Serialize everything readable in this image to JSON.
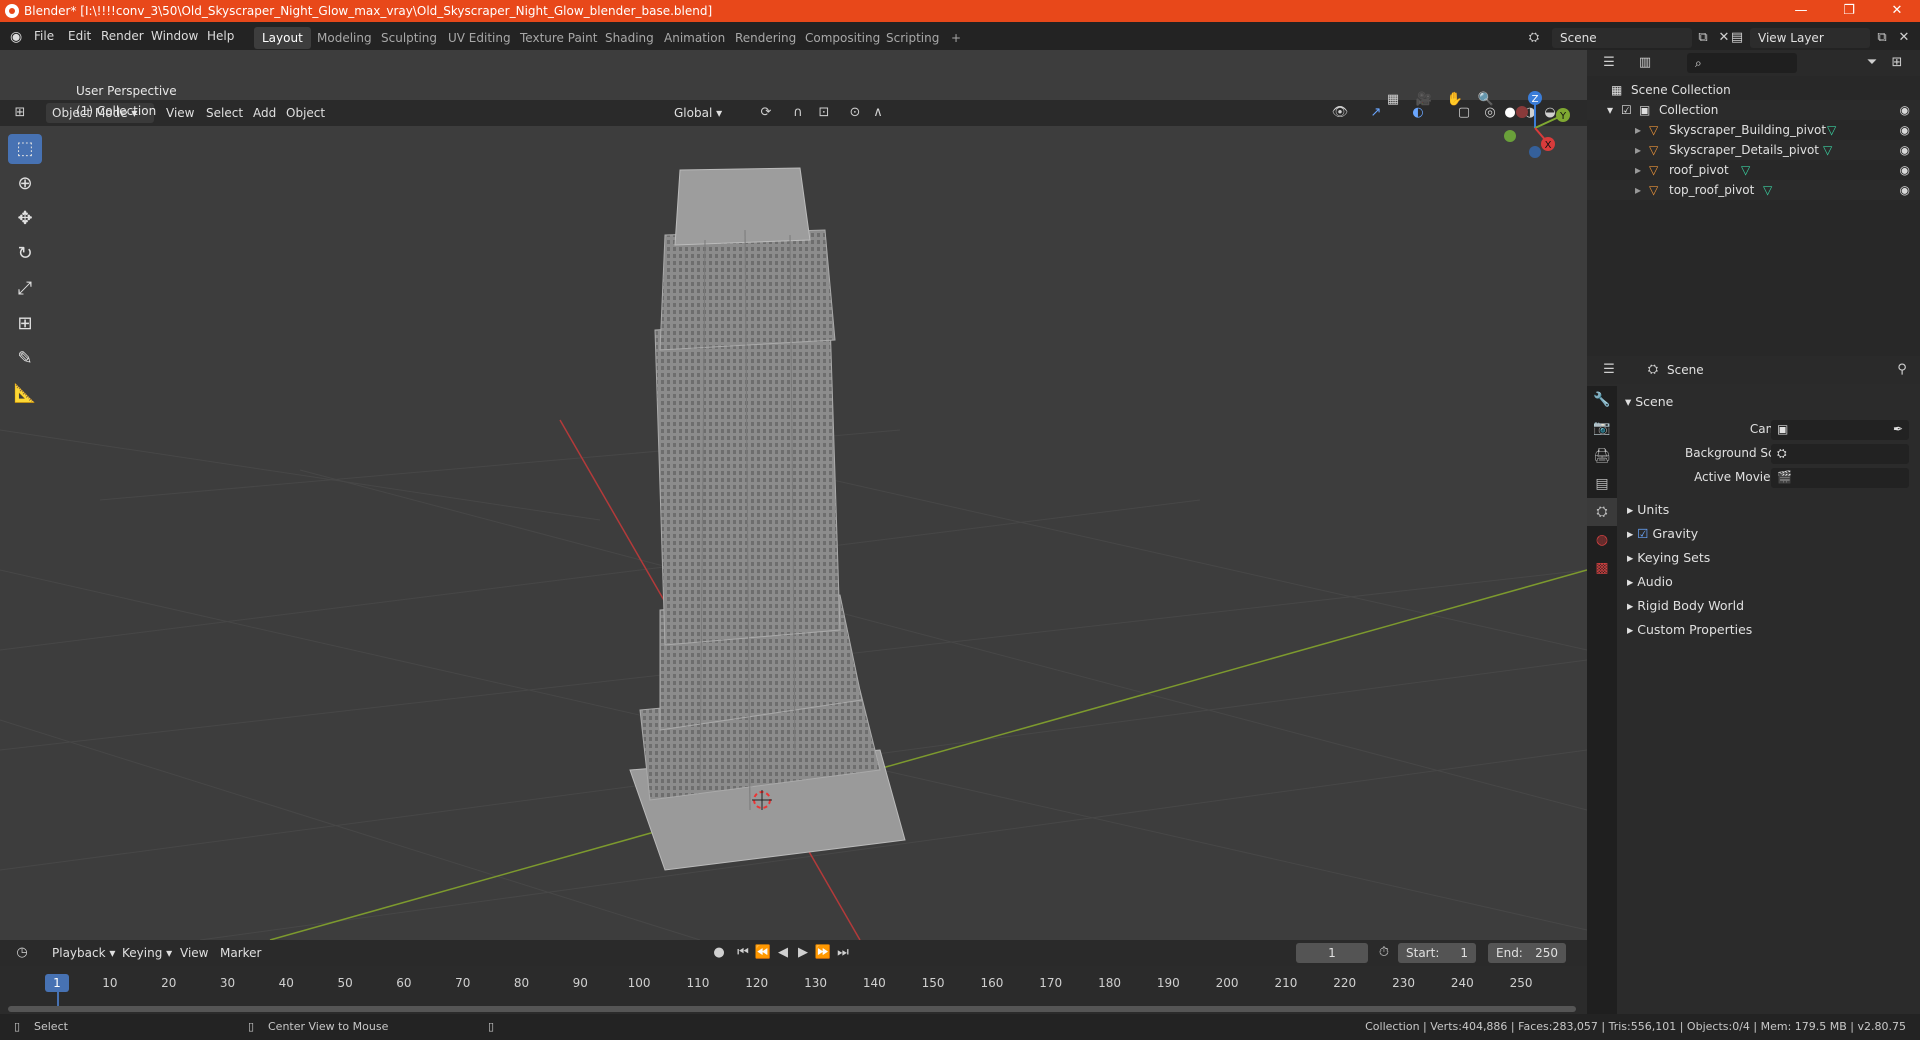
{
  "window": {
    "title": "Blender* [I:\\!!!!conv_3\\50\\Old_Skyscraper_Night_Glow_max_vray\\Old_Skyscraper_Night_Glow_blender_base.blend]",
    "minimize": "—",
    "maximize": "❐",
    "close": "✕"
  },
  "menu": [
    "File",
    "Edit",
    "Render",
    "Window",
    "Help"
  ],
  "workspaces": [
    "Layout",
    "Modeling",
    "Sculpting",
    "UV Editing",
    "Texture Paint",
    "Shading",
    "Animation",
    "Rendering",
    "Compositing",
    "Scripting"
  ],
  "workspace_add": "+",
  "scene_field": "Scene",
  "view_layer_field": "View Layer",
  "viewport_header": {
    "mode": "Object Mode",
    "menus": [
      "View",
      "Select",
      "Add",
      "Object"
    ],
    "orientation": "Global"
  },
  "viewport_overlay": {
    "view_name": "User Perspective",
    "collection": "(1) Collection"
  },
  "gizmo": {
    "x": "X",
    "y": "Y",
    "z": "Z"
  },
  "outliner": {
    "root": "Scene Collection",
    "collection": "Collection",
    "items": [
      "Skyscraper_Building_pivot",
      "Skyscraper_Details_pivot",
      "roof_pivot",
      "top_roof_pivot"
    ]
  },
  "properties": {
    "header": "Scene",
    "section": "Scene",
    "camera_label": "Camera",
    "background_label": "Background Scene",
    "movieclip_label": "Active Movie Clip",
    "subsections": [
      "Units",
      "Gravity",
      "Keying Sets",
      "Audio",
      "Rigid Body World",
      "Custom Properties"
    ]
  },
  "timeline": {
    "menus": [
      "Playback",
      "Keying",
      "View",
      "Marker"
    ],
    "current_frame": "1",
    "start_label": "Start:",
    "start_value": "1",
    "end_label": "End:",
    "end_value": "250",
    "ticks": [
      "1",
      "10",
      "20",
      "30",
      "40",
      "50",
      "60",
      "70",
      "80",
      "90",
      "100",
      "110",
      "120",
      "130",
      "140",
      "150",
      "160",
      "170",
      "180",
      "190",
      "200",
      "210",
      "220",
      "230",
      "240",
      "250"
    ],
    "tick_frames": [
      1,
      10,
      20,
      30,
      40,
      50,
      60,
      70,
      80,
      90,
      100,
      110,
      120,
      130,
      140,
      150,
      160,
      170,
      180,
      190,
      200,
      210,
      220,
      230,
      240,
      250
    ]
  },
  "status": {
    "left": "Select",
    "middle": "Center View to Mouse",
    "right": "Collection | Verts:404,886 | Faces:283,057 | Tris:556,101 | Objects:0/4 | Mem: 179.5 MB | v2.80.75"
  }
}
